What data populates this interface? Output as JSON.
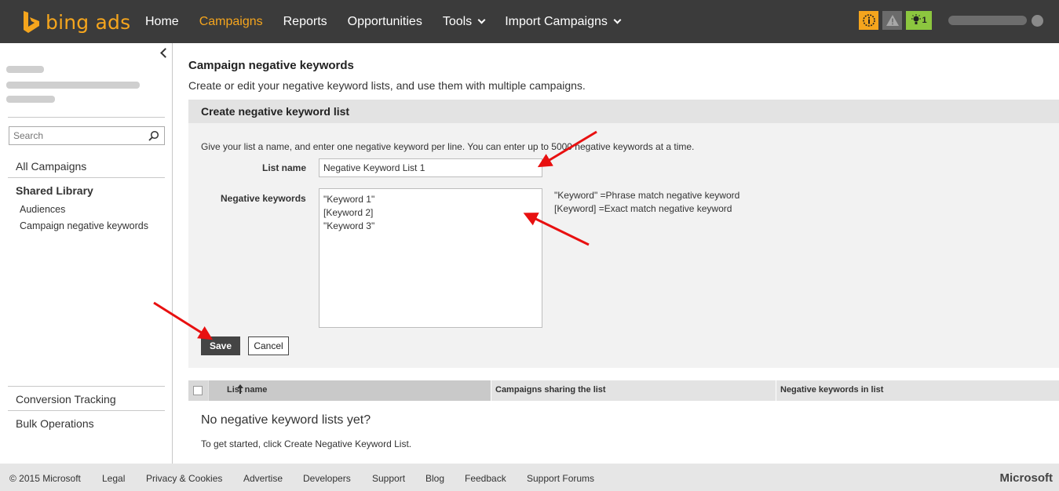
{
  "app": {
    "logo_text": "bing ads"
  },
  "nav": {
    "items": [
      {
        "label": "Home"
      },
      {
        "label": "Campaigns"
      },
      {
        "label": "Reports"
      },
      {
        "label": "Opportunities"
      },
      {
        "label": "Tools"
      },
      {
        "label": "Import Campaigns"
      }
    ],
    "tip_count": "1"
  },
  "sidebar": {
    "search_placeholder": "Search",
    "all_campaigns": "All Campaigns",
    "shared_library": "Shared Library",
    "sub_items": [
      {
        "label": "Audiences"
      },
      {
        "label": "Campaign negative keywords"
      }
    ],
    "conversion_tracking": "Conversion Tracking",
    "bulk_operations": "Bulk Operations"
  },
  "main": {
    "title": "Campaign negative keywords",
    "description": "Create or edit your negative keyword lists, and use them with multiple campaigns.",
    "panel": {
      "heading": "Create negative keyword list",
      "instructions": "Give your list a name, and enter one negative keyword per line. You can enter up to 5000 negative keywords at a time.",
      "list_name_label": "List name",
      "list_name_value": "Negative Keyword List 1",
      "keywords_label": "Negative keywords",
      "keywords": [
        "\"Keyword 1\"",
        "[Keyword 2]",
        "\"Keyword 3\""
      ],
      "hint_phrase": "\"Keyword\" =Phrase match negative keyword",
      "hint_exact": "[Keyword] =Exact match negative keyword",
      "save_label": "Save",
      "cancel_label": "Cancel"
    },
    "table": {
      "columns": [
        "List name",
        "Campaigns sharing the list",
        "Negative keywords in list"
      ],
      "empty_title": "No negative keyword lists yet?",
      "empty_desc": "To get started, click Create Negative Keyword List."
    }
  },
  "footer": {
    "copyright": "© 2015 Microsoft",
    "links": [
      {
        "label": "Legal"
      },
      {
        "label": "Privacy & Cookies"
      },
      {
        "label": "Advertise"
      },
      {
        "label": "Developers"
      },
      {
        "label": "Support"
      },
      {
        "label": "Blog"
      },
      {
        "label": "Feedback"
      },
      {
        "label": "Support Forums"
      }
    ],
    "brand": "Microsoft"
  },
  "colors": {
    "accent": "#f5a51d",
    "topbar": "#3b3b3b",
    "annotation_arrow": "#e81010"
  }
}
